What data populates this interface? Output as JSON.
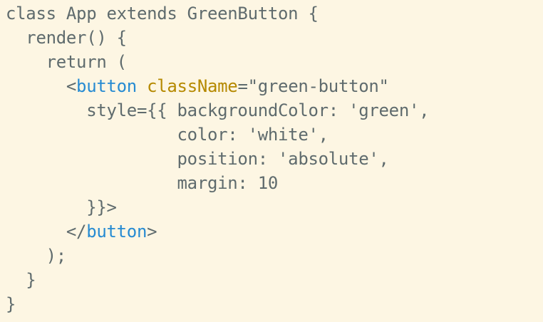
{
  "colors": {
    "background": "#fdf6e3",
    "text": "#5f6b6d",
    "tag": "#268bd2",
    "attribute": "#b58900"
  },
  "code": {
    "lines": [
      [
        {
          "t": "class App extends GreenButton {",
          "k": "plain"
        }
      ],
      [
        {
          "t": "  render() {",
          "k": "plain"
        }
      ],
      [
        {
          "t": "    return (",
          "k": "plain"
        }
      ],
      [
        {
          "t": "      <",
          "k": "plain"
        },
        {
          "t": "button",
          "k": "tag"
        },
        {
          "t": " ",
          "k": "plain"
        },
        {
          "t": "className",
          "k": "attr"
        },
        {
          "t": "=\"green-button\"",
          "k": "plain"
        }
      ],
      [
        {
          "t": "        style={{ backgroundColor: 'green',",
          "k": "plain"
        }
      ],
      [
        {
          "t": "                 color: 'white',",
          "k": "plain"
        }
      ],
      [
        {
          "t": "                 position: 'absolute',",
          "k": "plain"
        }
      ],
      [
        {
          "t": "                 margin: 10",
          "k": "plain"
        }
      ],
      [
        {
          "t": "        }}>",
          "k": "plain"
        }
      ],
      [
        {
          "t": "      </",
          "k": "plain"
        },
        {
          "t": "button",
          "k": "tag"
        },
        {
          "t": ">",
          "k": "plain"
        }
      ],
      [
        {
          "t": "    );",
          "k": "plain"
        }
      ],
      [
        {
          "t": "  }",
          "k": "plain"
        }
      ],
      [
        {
          "t": "}",
          "k": "plain"
        }
      ]
    ]
  }
}
